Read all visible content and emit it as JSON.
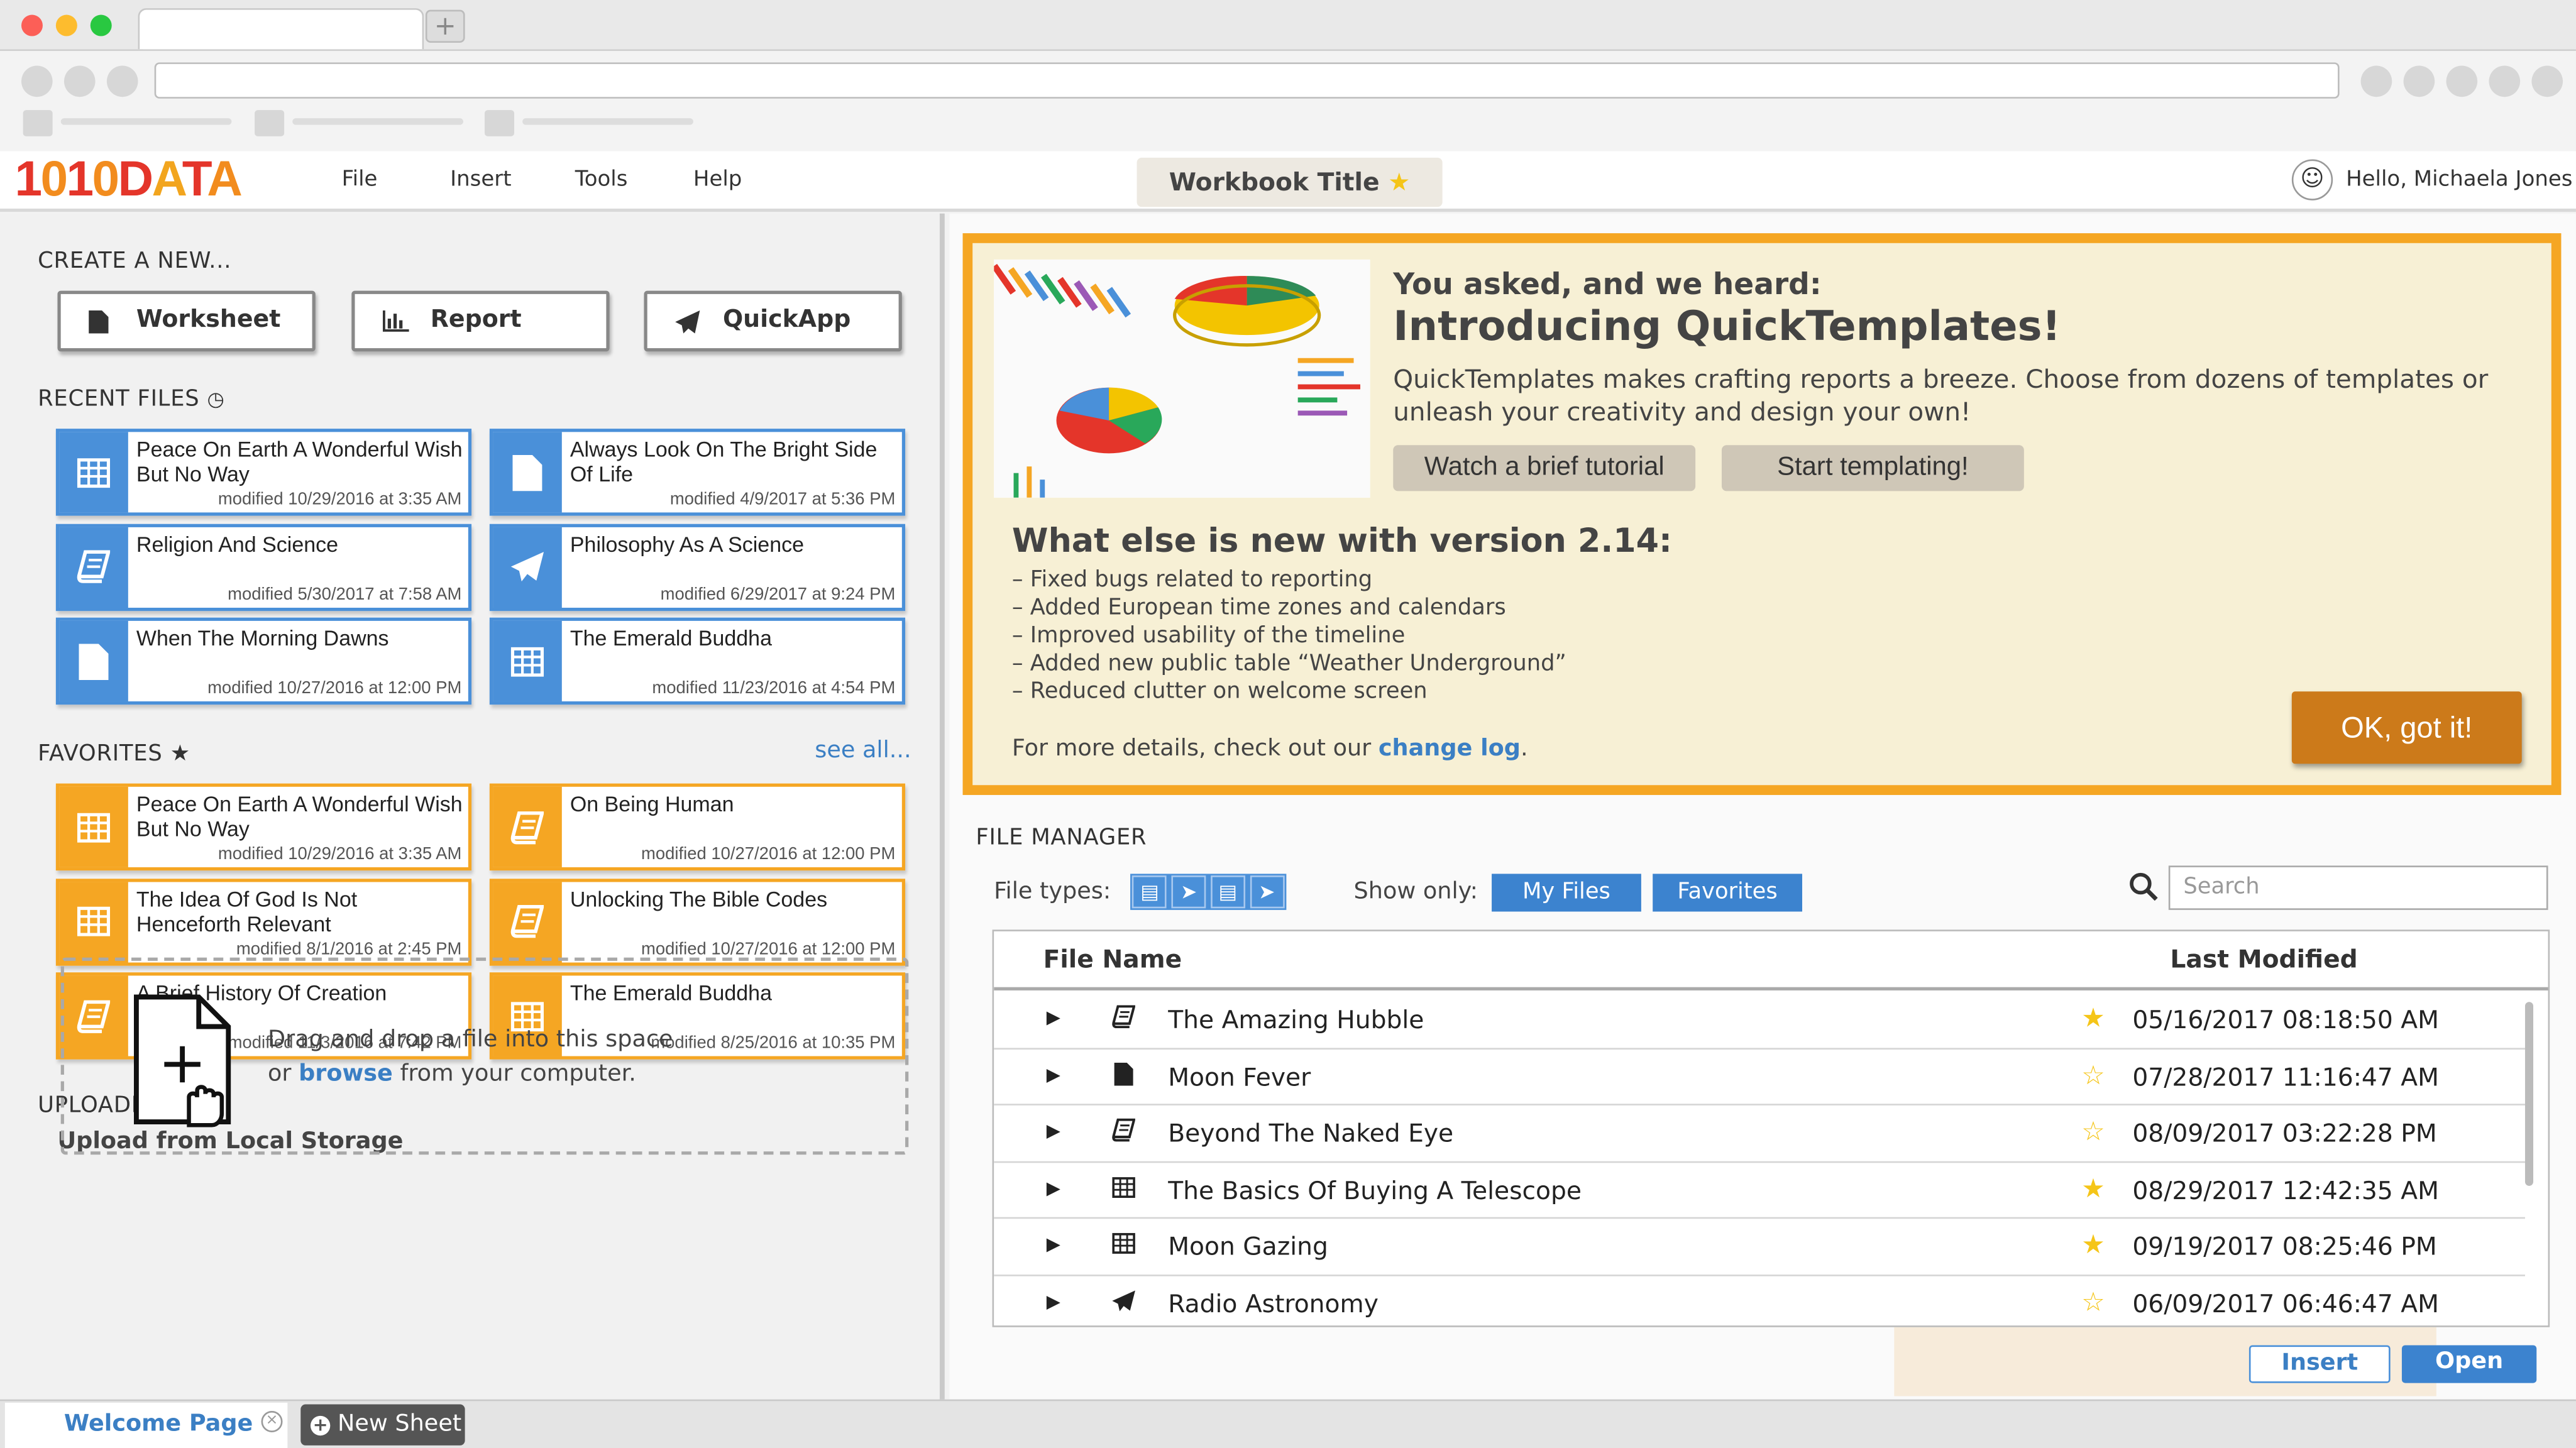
{
  "app": {
    "logo": "1010DATA",
    "menu": [
      "File",
      "Insert",
      "Tools",
      "Help"
    ],
    "workbook_title": "Workbook Title",
    "user_greeting": "Hello, Michaela Jones"
  },
  "create": {
    "heading": "CREATE A NEW...",
    "buttons": [
      {
        "label": "Worksheet",
        "icon": "document-icon"
      },
      {
        "label": "Report",
        "icon": "bar-chart-icon"
      },
      {
        "label": "QuickApp",
        "icon": "paper-plane-icon"
      }
    ]
  },
  "recent": {
    "heading": "RECENT FILES",
    "files": [
      {
        "title": "Peace On Earth A Wonderful Wish But No Way",
        "modified": "modified 10/29/2016 at 3:35 AM",
        "icon": "table-icon"
      },
      {
        "title": "Always Look On The Bright Side Of Life",
        "modified": "modified 4/9/2017 at 5:36 PM",
        "icon": "document-icon"
      },
      {
        "title": "Religion And Science",
        "modified": "modified 5/30/2017 at 7:58 AM",
        "icon": "book-icon"
      },
      {
        "title": "Philosophy As A Science",
        "modified": "modified 6/29/2017 at 9:24 PM",
        "icon": "paper-plane-icon"
      },
      {
        "title": "When The Morning Dawns",
        "modified": "modified 10/27/2016 at 12:00 PM",
        "icon": "document-icon"
      },
      {
        "title": "The Emerald Buddha",
        "modified": "modified 11/23/2016 at 4:54 PM",
        "icon": "table-icon"
      }
    ]
  },
  "favorites": {
    "heading": "FAVORITES",
    "see_all": "see all...",
    "files": [
      {
        "title": "Peace On Earth A Wonderful Wish But No Way",
        "modified": "modified 10/29/2016 at 3:35 AM",
        "icon": "table-icon"
      },
      {
        "title": "On Being Human",
        "modified": "modified 10/27/2016 at 12:00 PM",
        "icon": "book-icon"
      },
      {
        "title": "The Idea Of God Is Not Henceforth Relevant",
        "modified": "modified 8/1/2016 at 2:45 PM",
        "icon": "table-icon"
      },
      {
        "title": "Unlocking The Bible Codes",
        "modified": "modified 10/27/2016 at 12:00 PM",
        "icon": "book-icon"
      },
      {
        "title": "A Brief History Of Creation",
        "modified": "modified 11/3/2016 at 7:42 PM",
        "icon": "book-icon"
      },
      {
        "title": "The Emerald Buddha",
        "modified": "modified 8/25/2016 at 10:35 PM",
        "icon": "table-icon"
      }
    ]
  },
  "uploading": {
    "heading": "UPLOADING",
    "subheading": "Upload from Local Storage",
    "line1": "Drag and drop a file into this space",
    "line2_prefix": "or",
    "browse": "browse",
    "line2_suffix": "from your computer."
  },
  "banner": {
    "kicker": "You asked, and we heard:",
    "title": "Introducing QuickTemplates!",
    "body": "QuickTemplates makes crafting  reports a breeze.  Choose from dozens of templates or unleash your creativity and design your own!",
    "btn_tutorial": "Watch a brief tutorial",
    "btn_start": "Start templating!",
    "whats_new": "What else is new with version 2.14:",
    "bullets": [
      "– Fixed bugs related to reporting",
      "– Added European time zones and calendars",
      "– Improved usability of the timeline",
      "– Added new public table “Weather Underground”",
      "– Reduced clutter on welcome screen"
    ],
    "details_prefix": "For more details, check out our",
    "details_link": "change log",
    "details_suffix": ".",
    "ok": "OK, got it!"
  },
  "file_manager": {
    "heading": "FILE MANAGER",
    "file_types_label": "File types:",
    "show_only_label": "Show only:",
    "show_my_files": "My Files",
    "show_favorites": "Favorites",
    "search_placeholder": "Search",
    "col_name": "File Name",
    "col_modified": "Last Modified",
    "rows": [
      {
        "name": "The Amazing Hubble",
        "modified": "05/16/2017 08:18:50 AM",
        "icon": "book-icon",
        "favorite": true
      },
      {
        "name": "Moon Fever",
        "modified": "07/28/2017 11:16:47 AM",
        "icon": "document-icon",
        "favorite": false
      },
      {
        "name": "Beyond The Naked Eye",
        "modified": "08/09/2017 03:22:28 PM",
        "icon": "book-icon",
        "favorite": false
      },
      {
        "name": "The Basics Of Buying A Telescope",
        "modified": "08/29/2017 12:42:35 AM",
        "icon": "table-icon",
        "favorite": true
      },
      {
        "name": "Moon Gazing",
        "modified": "09/19/2017 08:25:46 PM",
        "icon": "table-icon",
        "favorite": true
      },
      {
        "name": "Radio Astronomy",
        "modified": "06/09/2017 06:46:47 AM",
        "icon": "paper-plane-icon",
        "favorite": false
      }
    ],
    "insert": "Insert",
    "open": "Open"
  },
  "tabs": {
    "welcome": "Welcome Page",
    "new_sheet": "New Sheet"
  },
  "colors": {
    "accent_blue": "#4a90d9",
    "accent_orange": "#f5a623",
    "banner_bg": "#f7f0d5",
    "ok_button": "#cc7a1a"
  }
}
